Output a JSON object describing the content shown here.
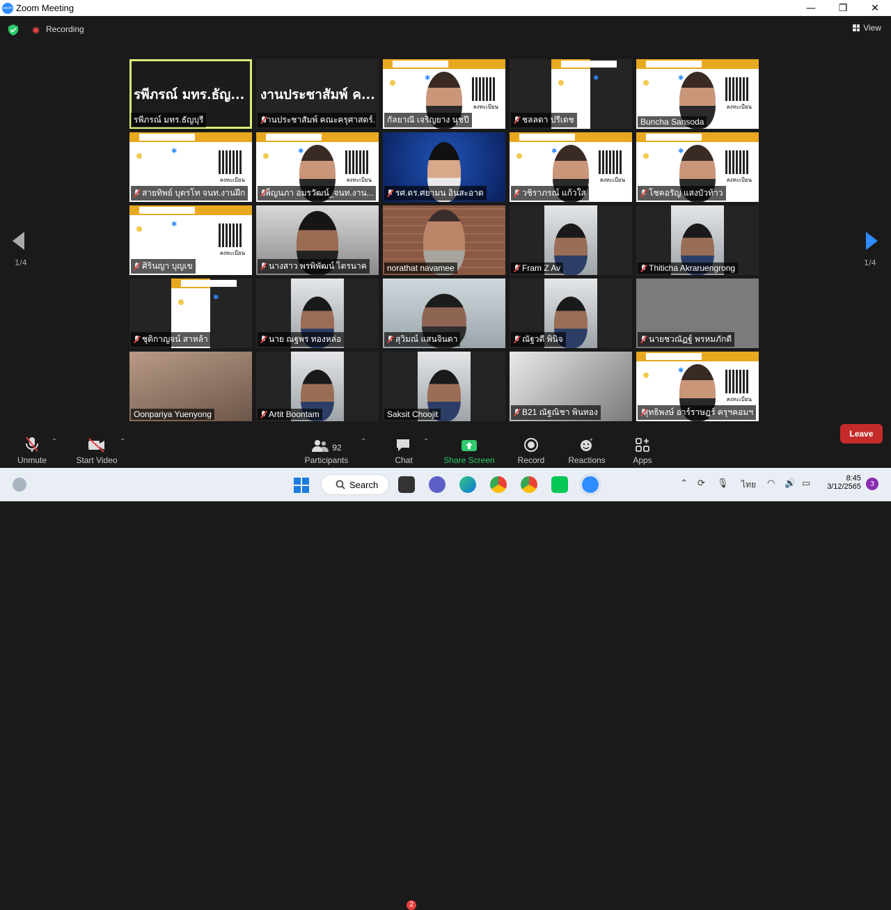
{
  "window": {
    "title": "Zoom Meeting",
    "minimize": "—",
    "maximize": "❐",
    "close": "✕"
  },
  "topbar": {
    "recording_label": "Recording",
    "view_label": "View"
  },
  "pagination": {
    "left": "1/4",
    "right": "1/4"
  },
  "tiles": [
    {
      "name": "รพีภรณ์ มทร.ธัญบุรี",
      "big": "รพีภรณ์ มทร.ธัญ...",
      "muted": false,
      "kind": "name-only",
      "active": true
    },
    {
      "name": "งานประชาสัมพ์ คณะครุศาสตร์...",
      "big": "งานประชาสัมพ์ ค...",
      "muted": true,
      "kind": "name-only"
    },
    {
      "name": "กัลยาณี เจริญยาง นุชปี",
      "muted": false,
      "kind": "poster-person"
    },
    {
      "name": "ชลลดา ปรีเดช",
      "muted": true,
      "kind": "poster-narrow"
    },
    {
      "name": "Buncha Sansoda",
      "muted": false,
      "kind": "poster-person"
    },
    {
      "name": "สายทิพย์ บุตรโท จนท.งานฝึก",
      "muted": true,
      "kind": "poster"
    },
    {
      "name": "เพ็ญนภา อมรวัฒน์_จนท.งาน...",
      "muted": true,
      "kind": "poster-person"
    },
    {
      "name": "รศ.ดร.ศยามน อินสะอาด",
      "muted": true,
      "kind": "blue"
    },
    {
      "name": "วชิราภรณ์ แก้วใส",
      "muted": true,
      "kind": "poster-person"
    },
    {
      "name": "โชคอรัญ แสงบัวท้าว",
      "muted": true,
      "kind": "poster-person"
    },
    {
      "name": "ศิรินญา บุญเข",
      "muted": true,
      "kind": "poster"
    },
    {
      "name": "นางสาว พรพิพัฒน์ ไตรนาค",
      "muted": true,
      "kind": "gray-person"
    },
    {
      "name": "norathat navamee",
      "muted": false,
      "kind": "brick"
    },
    {
      "name": "Fram Z Av",
      "muted": true,
      "kind": "narrow-person"
    },
    {
      "name": "Thiticha Akraruengrong",
      "muted": true,
      "kind": "narrow-person"
    },
    {
      "name": "ชุติกาญจน์ สาหล้า",
      "muted": true,
      "kind": "poster-narrow"
    },
    {
      "name": "นาย ณฐพร ทองหล่อ",
      "muted": true,
      "kind": "narrow-person"
    },
    {
      "name": "สุวิมณ์ แสนจินดา",
      "muted": true,
      "kind": "light-person"
    },
    {
      "name": "ณัฐวดี พินิจ",
      "muted": true,
      "kind": "narrow-person"
    },
    {
      "name": "นายชวณัฏฐ์ พรหมภักดี",
      "muted": true,
      "kind": "gray"
    },
    {
      "name": "Oonpariya Yuenyong",
      "muted": false,
      "kind": "warm"
    },
    {
      "name": "Artit Boontam",
      "muted": true,
      "kind": "narrow-person"
    },
    {
      "name": "Saksit Choojit",
      "muted": false,
      "kind": "narrow-person"
    },
    {
      "name": "B21 ณัฐณิชา พินทอง",
      "muted": true,
      "kind": "gray"
    },
    {
      "name": "สุทธิพงษ์ อาร์ราษฎร์ ครุฯคอมฯ",
      "muted": true,
      "kind": "poster-person"
    }
  ],
  "poster": {
    "qr_caption": "ลงทะเบียน"
  },
  "toolbar": {
    "unmute": "Unmute",
    "start_video": "Start Video",
    "participants": "Participants",
    "participants_count": "92",
    "chat": "Chat",
    "chat_badge": "2",
    "share_screen": "Share Screen",
    "record": "Record",
    "reactions": "Reactions",
    "apps": "Apps",
    "leave": "Leave"
  },
  "taskbar": {
    "search_label": "Search",
    "language": "ไทย",
    "time": "8:45",
    "date": "3/12/2565",
    "notification_count": "3"
  },
  "colors": {
    "accent": "#2d8cff",
    "leave": "#c52b2b",
    "share": "#2fca6b",
    "active_border": "#d9f078"
  }
}
